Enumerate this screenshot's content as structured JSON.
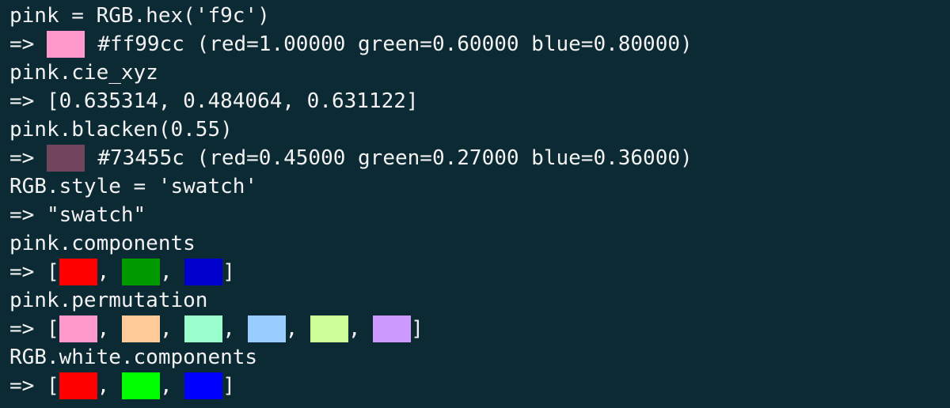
{
  "terminal": {
    "line1": "pink = RGB.hex('f9c')",
    "line2": {
      "arrow": "=>",
      "swatch_color": "#ff99cc",
      "text": "#ff99cc (red=1.00000 green=0.60000 blue=0.80000)"
    },
    "line3": "pink.cie_xyz",
    "line4": "=> [0.635314, 0.484064, 0.631122]",
    "line5": "pink.blacken(0.55)",
    "line6": {
      "arrow": "=>",
      "swatch_color": "#73455c",
      "text": "#73455c (red=0.45000 green=0.27000 blue=0.36000)"
    },
    "line7": "RGB.style = 'swatch'",
    "line8": "=> \"swatch\"",
    "line9": "pink.components",
    "line10": {
      "prefix": "=> [",
      "separator": ",",
      "suffix": "]",
      "swatches": [
        "#ff0000",
        "#009900",
        "#0000cc"
      ]
    },
    "line11": "pink.permutation",
    "line12": {
      "prefix": "=> [",
      "separator": ",",
      "suffix": "]",
      "swatches": [
        "#ff99cc",
        "#ffcc99",
        "#99ffcc",
        "#99ccff",
        "#ccff99",
        "#cc99ff"
      ]
    },
    "line13": "RGB.white.components",
    "line14": {
      "prefix": "=> [",
      "separator": ",",
      "suffix": "]",
      "swatches": [
        "#ff0000",
        "#00ff00",
        "#0000ff"
      ]
    }
  }
}
